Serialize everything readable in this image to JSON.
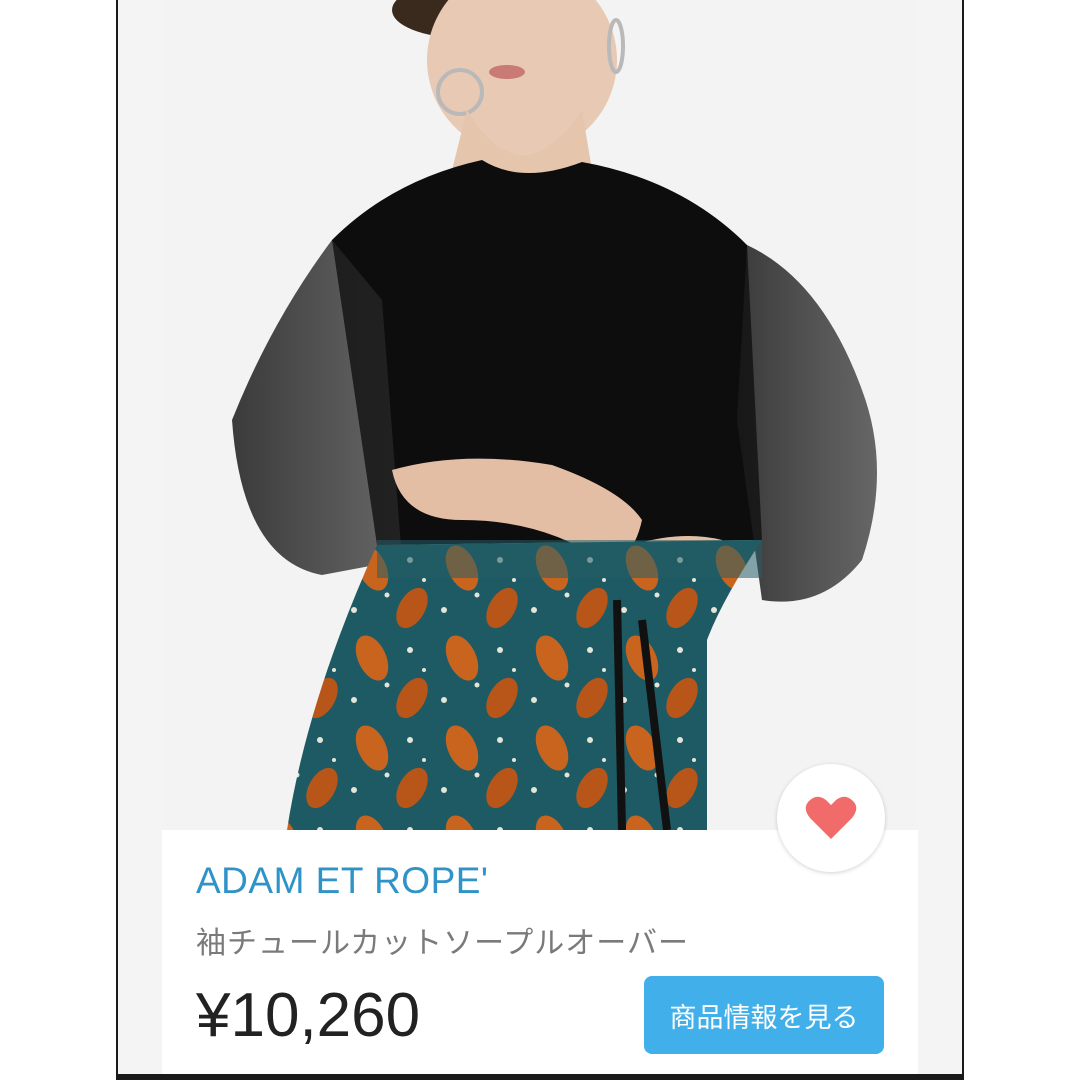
{
  "product": {
    "brand": "ADAM ET ROPE'",
    "name": "袖チュールカットソープルオーバー",
    "price": "¥10,260",
    "cta_label": "商品情報を見る"
  },
  "icons": {
    "favorite": "heart-icon"
  },
  "colors": {
    "brand_text": "#2f93c8",
    "cta_background": "#41b0ea",
    "heart": "#f26b6b"
  }
}
